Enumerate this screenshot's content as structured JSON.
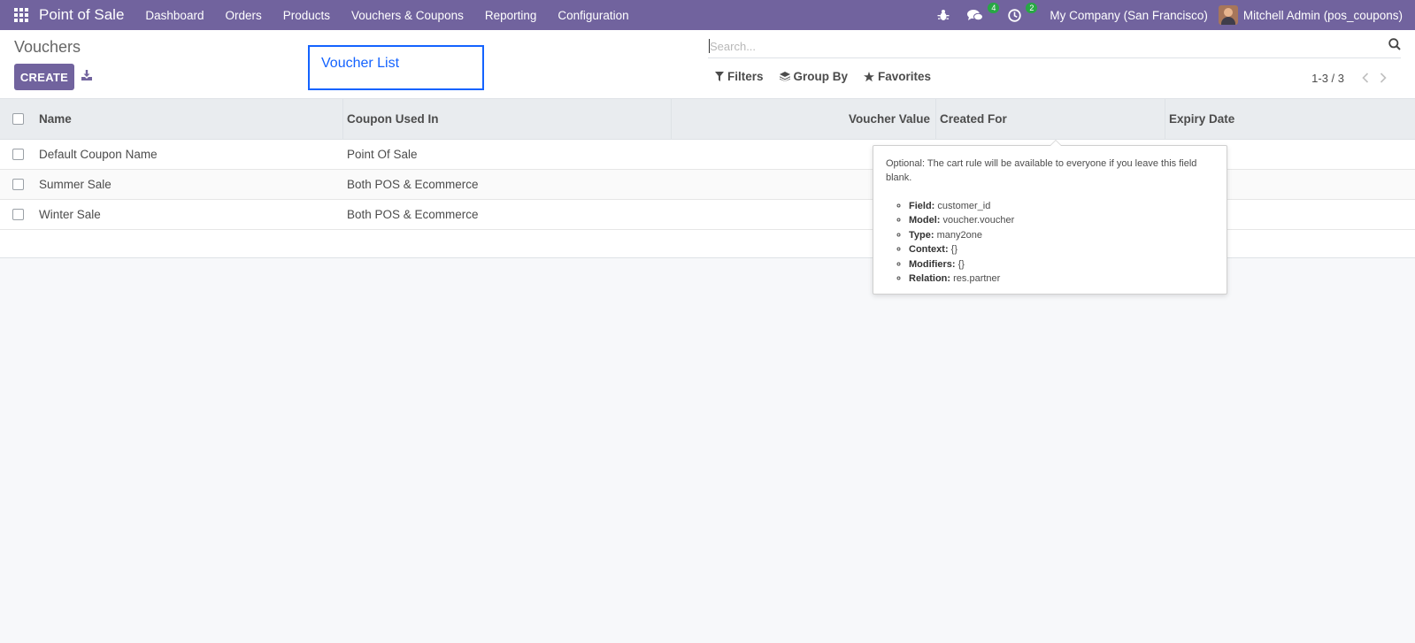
{
  "navbar": {
    "app_name": "Point of Sale",
    "menu": [
      "Dashboard",
      "Orders",
      "Products",
      "Vouchers & Coupons",
      "Reporting",
      "Configuration"
    ],
    "messages_badge": "4",
    "activities_badge": "2",
    "company": "My Company (San Francisco)",
    "user": "Mitchell Admin (pos_coupons)",
    "color": "#71639e"
  },
  "control_panel": {
    "title": "Vouchers",
    "create_label": "CREATE",
    "annotation": "Voucher List",
    "search_placeholder": "Search...",
    "filters_label": "Filters",
    "groupby_label": "Group By",
    "favorites_label": "Favorites",
    "pager": "1-3 / 3"
  },
  "table": {
    "headers": {
      "name": "Name",
      "used_in": "Coupon Used In",
      "value": "Voucher Value",
      "created_for": "Created For",
      "expiry": "Expiry Date"
    },
    "rows": [
      {
        "name": "Default Coupon Name",
        "used_in": "Point Of Sale"
      },
      {
        "name": "Summer Sale",
        "used_in": "Both POS & Ecommerce"
      },
      {
        "name": "Winter Sale",
        "used_in": "Both POS & Ecommerce"
      }
    ]
  },
  "tooltip": {
    "help": "Optional: The cart rule will be available to everyone if you leave this field blank.",
    "items": [
      {
        "label": "Field:",
        "value": "customer_id"
      },
      {
        "label": "Model:",
        "value": "voucher.voucher"
      },
      {
        "label": "Type:",
        "value": "many2one"
      },
      {
        "label": "Context:",
        "value": "{}"
      },
      {
        "label": "Modifiers:",
        "value": "{}"
      },
      {
        "label": "Relation:",
        "value": "res.partner"
      }
    ]
  }
}
